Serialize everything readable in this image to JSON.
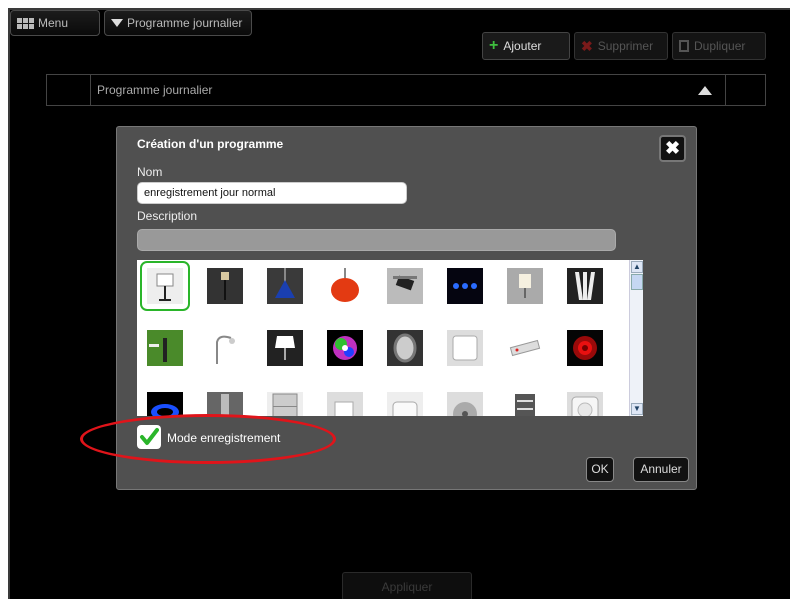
{
  "topbar": {
    "menu_label": "Menu",
    "programme_label": "Programme journalier"
  },
  "actions": {
    "add_label": "Ajouter",
    "delete_label": "Supprimer",
    "duplicate_label": "Dupliquer"
  },
  "programme_row": {
    "label": "Programme journalier"
  },
  "dialog": {
    "title": "Création d'un programme",
    "name_label": "Nom",
    "name_value": "enregistrement jour normal",
    "description_label": "Description",
    "description_value": "",
    "mode_label": "Mode enregistrement",
    "mode_checked": true,
    "ok_label": "OK",
    "cancel_label": "Annuler"
  },
  "gallery": {
    "selected_index": 0,
    "icons": [
      "floor-lamp-icon",
      "standing-lamp-icon",
      "blue-pendant-lamp-icon",
      "orange-pendant-lamp-icon",
      "spotlight-icon",
      "blue-led-strip-icon",
      "wall-sconce-icon",
      "fluorescent-tubes-icon",
      "garden-bollard-light-icon",
      "arc-floor-lamp-icon",
      "table-lamp-icon",
      "rgb-color-bulb-icon",
      "outdoor-bulkhead-light-icon",
      "wall-switch-icon",
      "power-strip-icon",
      "red-hotplate-icon",
      "gas-burner-icon",
      "tall-lamp-icon",
      "refrigerator-icon",
      "coffee-mug-icon",
      "toaster-icon",
      "fan-icon",
      "towel-radiator-icon",
      "wall-socket-icon"
    ]
  },
  "bottom": {
    "apply_label": "Appliquer"
  },
  "colors": {
    "background": "#000000",
    "dialog": "#505050",
    "accent_green": "#3fbf3f",
    "annotation_red": "#e0141a"
  }
}
